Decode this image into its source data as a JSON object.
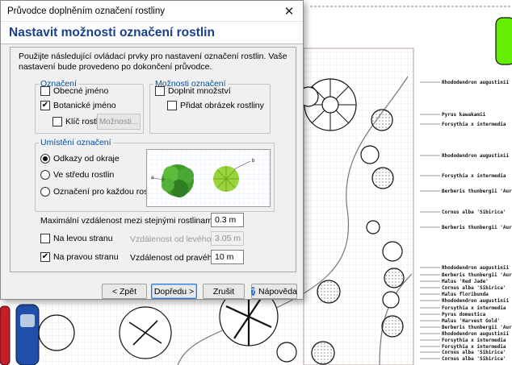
{
  "window": {
    "title": "Průvodce doplněním označení rostliny",
    "close_glyph": "✕"
  },
  "header": {
    "heading": "Nastavit možnosti označení rostlin"
  },
  "intro": "Použijte následující ovládací prvky pro nastavení označení rostlin. Vaše nastavení bude provedeno po dokončení průvodce.",
  "labeling": {
    "legend": "Označení",
    "common_name": {
      "label": "Obecné jméno",
      "checked": false
    },
    "botanical_name": {
      "label": "Botanické jméno",
      "checked": true
    },
    "plant_key": {
      "label": "Klíč rostliny",
      "checked": false
    },
    "options_button": "Možnosti..."
  },
  "label_options": {
    "legend": "Možnosti označení",
    "add_quantity": {
      "label": "Doplnit množství",
      "checked": false
    },
    "add_plant_image": {
      "label": "Přidat obrázek rostliny",
      "checked": false
    }
  },
  "placement": {
    "legend": "Umístění označení",
    "options": [
      {
        "label": "Odkazy od okraje",
        "selected": true
      },
      {
        "label": "Ve středu rostlin",
        "selected": false
      },
      {
        "label": "Označení pro každou rostlinu",
        "selected": false
      }
    ],
    "preview": {
      "label_a": "a",
      "label_b": "b"
    }
  },
  "distance": {
    "max_label": "Maximální vzdálenost mezi stejnými rostlinami:",
    "max_value": "0.3 m",
    "left_side": {
      "label": "Na levou stranu",
      "checked": false
    },
    "left_distance_label": "Vzdálenost od levého",
    "left_distance_value": "3.05 m",
    "right_side": {
      "label": "Na pravou stranu",
      "checked": true
    },
    "right_distance_label": "Vzdálenost od pravého",
    "right_distance_value": "10 m"
  },
  "buttons": {
    "back": "< Zpět",
    "next": "Dopředu >",
    "cancel": "Zrušit",
    "help": "Nápověda",
    "help_glyph": "?"
  },
  "drawing": {
    "plant_labels": [
      "Rhododendron augustinii",
      "Pyrus kawakamii",
      "Forsythia x intermedia",
      "Rhododendron augustinii",
      "Forsythia x intermedia",
      "Berberis thunbergii 'Aurea'",
      "Cornus alba 'Sibirica'",
      "Berberis thunbergii 'Aurea'",
      "Rhododendron augustinii",
      "Berberis thunbergii 'Aurea'",
      "Malus 'Red Jade'",
      "Cornus alba 'Sibirica'",
      "Malus floribunda",
      "Rhododendron augustinii",
      "Forsythia x intermedia",
      "Pyrus domestica",
      "Malus 'Harvest Gold'",
      "Berberis thunbergii 'Aurea'",
      "Rhododendron augustinii",
      "Forsythia x intermedia",
      "Forsythia x intermedia",
      "Cornus alba 'Sibirica'",
      "Cornus alba 'Sibirica'"
    ],
    "colors": {
      "green_tile": "#66ee00",
      "car_blue": "#1f4fa8",
      "car_red": "#c41e2a"
    }
  }
}
